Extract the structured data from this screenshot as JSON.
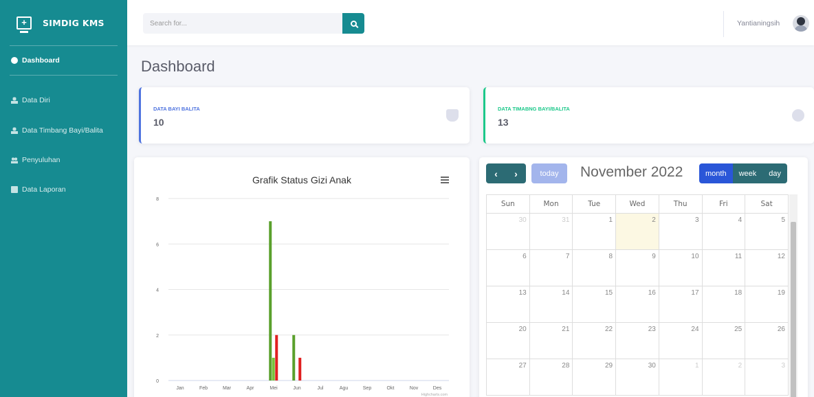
{
  "app": {
    "brand": "SIMDIG KMS"
  },
  "sidebar": {
    "items": [
      {
        "label": "Dashboard",
        "icon": "dashboard-icon",
        "active": true
      },
      {
        "label": "Data Diri",
        "icon": "user-icon"
      },
      {
        "label": "Data Timbang Bayi/Balita",
        "icon": "user-icon"
      },
      {
        "label": "Penyuluhan",
        "icon": "users-icon"
      },
      {
        "label": "Data Laporan",
        "icon": "report-icon"
      }
    ]
  },
  "topbar": {
    "search_placeholder": "Search for...",
    "user_name": "Yantianingsih"
  },
  "page": {
    "title": "Dashboard"
  },
  "stats": [
    {
      "label": "DATA BAYI BALITA",
      "value": "10",
      "icon": "baby-carriage-icon",
      "accent": "#4e73df"
    },
    {
      "label": "DATA TIMABNG BAYI/BALITA",
      "value": "13",
      "icon": "circle-icon",
      "accent": "#1cc88a"
    }
  ],
  "chart_data": {
    "type": "bar",
    "title": "Grafik Status Gizi Anak",
    "categories": [
      "Jan",
      "Feb",
      "Mar",
      "Apr",
      "Mei",
      "Jun",
      "Jul",
      "Agu",
      "Sep",
      "Okt",
      "Nov",
      "Des"
    ],
    "series": [
      {
        "color": "#5aa02c",
        "values": [
          0,
          0,
          0,
          0,
          7,
          2,
          0,
          0,
          0,
          0,
          0,
          0
        ]
      },
      {
        "color": "#78c23a",
        "values": [
          0,
          0,
          0,
          0,
          1,
          0,
          0,
          0,
          0,
          0,
          0,
          0
        ]
      },
      {
        "color": "#e02020",
        "values": [
          0,
          0,
          0,
          0,
          2,
          1,
          0,
          0,
          0,
          0,
          0,
          0
        ]
      }
    ],
    "ylim": [
      0,
      8
    ],
    "yticks": [
      0,
      2,
      4,
      6,
      8
    ],
    "grid": true,
    "credits": "Highcharts.com"
  },
  "calendar": {
    "title": "November 2022",
    "today_label": "today",
    "prev": "‹",
    "next": "›",
    "views": [
      "month",
      "week",
      "day"
    ],
    "active_view": "month",
    "weekdays": [
      "Sun",
      "Mon",
      "Tue",
      "Wed",
      "Thu",
      "Fri",
      "Sat"
    ],
    "weeks": [
      [
        {
          "d": "30",
          "o": true
        },
        {
          "d": "31",
          "o": true
        },
        {
          "d": "1"
        },
        {
          "d": "2",
          "t": true
        },
        {
          "d": "3"
        },
        {
          "d": "4"
        },
        {
          "d": "5"
        }
      ],
      [
        {
          "d": "6"
        },
        {
          "d": "7"
        },
        {
          "d": "8"
        },
        {
          "d": "9"
        },
        {
          "d": "10"
        },
        {
          "d": "11"
        },
        {
          "d": "12"
        }
      ],
      [
        {
          "d": "13"
        },
        {
          "d": "14"
        },
        {
          "d": "15"
        },
        {
          "d": "16"
        },
        {
          "d": "17"
        },
        {
          "d": "18"
        },
        {
          "d": "19"
        }
      ],
      [
        {
          "d": "20"
        },
        {
          "d": "21"
        },
        {
          "d": "22"
        },
        {
          "d": "23"
        },
        {
          "d": "24"
        },
        {
          "d": "25"
        },
        {
          "d": "26"
        }
      ],
      [
        {
          "d": "27"
        },
        {
          "d": "28"
        },
        {
          "d": "29"
        },
        {
          "d": "30"
        },
        {
          "d": "1",
          "o": true
        },
        {
          "d": "2",
          "o": true
        },
        {
          "d": "3",
          "o": true
        }
      ]
    ]
  }
}
